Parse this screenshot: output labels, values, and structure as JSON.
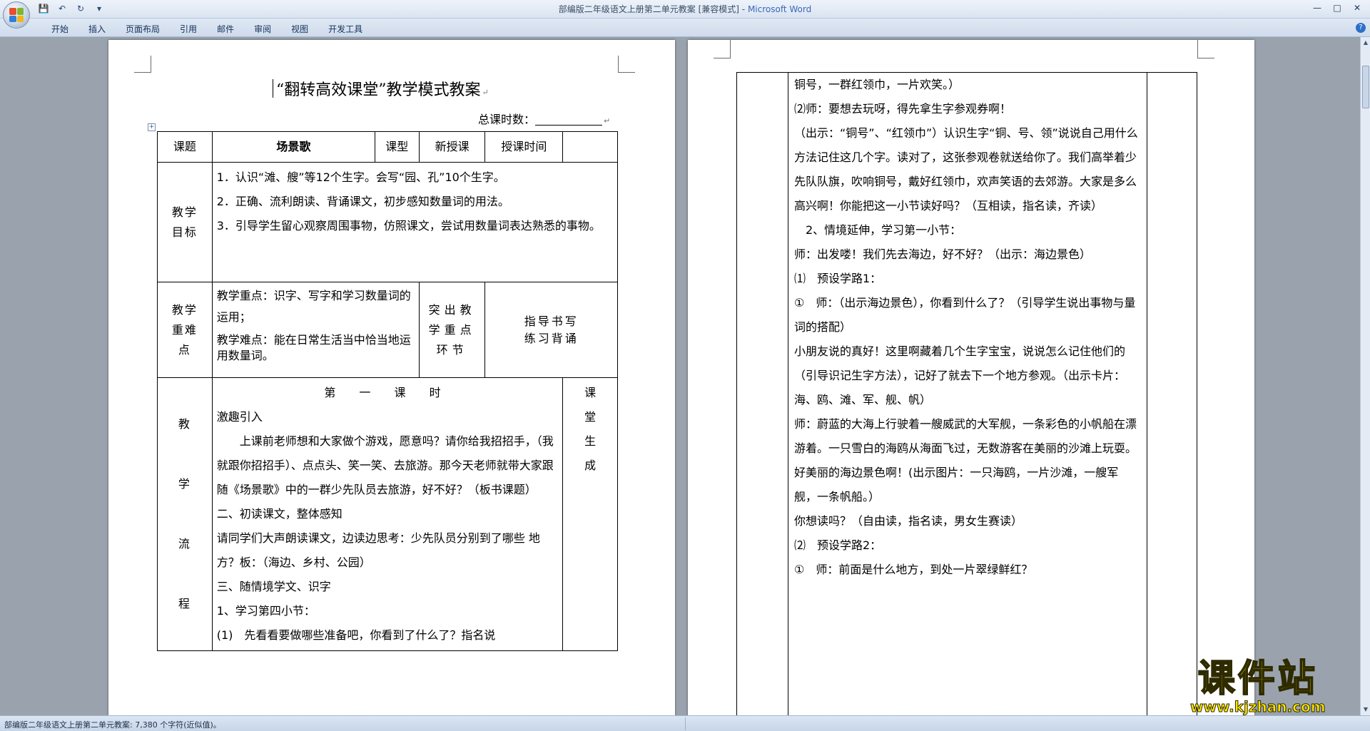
{
  "window": {
    "title": "部编版二年级语文上册第二单元教案 [兼容模式]",
    "app_name": "Microsoft Word"
  },
  "ribbon": {
    "tabs": [
      "开始",
      "插入",
      "页面布局",
      "引用",
      "邮件",
      "审阅",
      "视图",
      "开发工具"
    ]
  },
  "doc": {
    "title": "“翻转高效课堂”教学模式教案",
    "total_hours_label": "总课时数：",
    "header_row": {
      "subject_label": "课题",
      "subject": "场景歌",
      "type_label": "课型",
      "type": "新授课",
      "time_label": "授课时间",
      "time_value": ""
    },
    "goals_label": "教学目标",
    "goals": [
      "1．认识“滩、艘”等12个生字。会写“园、孔”10个生字。",
      "2．正确、流利朗读、背诵课文，初步感知数量词的用法。",
      "3．引导学生留心观察周围事物，仿照课文，尝试用数量词表达熟悉的事物。"
    ],
    "difficulty_label": "教学重难点",
    "key_point": "教学重点：识字、写字和学习数量词的运用；",
    "difficult_point": "教学难点：能在日常生活当中恰当地运用数量词。",
    "highlight_label": "突出教学重点环节",
    "highlight_value": "指导书写\n练习背诵",
    "process_label": "教学流程",
    "period_title": "第 一 课 时",
    "generate_label": "课堂生成",
    "process": [
      "激趣引入",
      "上课前老师想和大家做个游戏，愿意吗？请你给我招招手，（我就跟你招招手）、点点头、笑一笑、去旅游。那今天老师就带大家跟随《场景歌》中的一群少先队员去旅游，好不好？（板书课题）",
      "二、初读课文，整体感知",
      "请同学们大声朗读课文，边读边思考：少先队员分别到了哪些 地方？板：（海边、乡村、公园）",
      "三、随情境学文、识字",
      "1、学习第四小节：",
      "(1)　先看看要做哪些准备吧，你看到了什么了？指名说"
    ]
  },
  "page2": {
    "paragraphs": [
      "铜号，一群红领巾，一片欢笑。）",
      "⑵师：要想去玩呀，得先拿生字参观券啊！",
      "（出示：“铜号”、“红领巾”）认识生字“铜、号、领”说说自己用什么方法记住这几个字。读对了，这张参观卷就送给你了。我们高举着少先队队旗，吹响铜号，戴好红领巾，欢声笑语的去郊游。大家是多么高兴啊！你能把这一小节读好吗？（互相读，指名读，齐读）",
      "　2、情境延伸，学习第一小节：",
      "师：出发喽！我们先去海边，好不好？（出示：海边景色）",
      "⑴　预设学路1：",
      "①　师：（出示海边景色），你看到什么了？（引导学生说出事物与量词的搭配）",
      "小朋友说的真好！这里啊藏着几个生字宝宝，说说怎么记住他们的（引导识记生字方法），记好了就去下一个地方参观。（出示卡片：海、鸥、滩、军、舰、帆）",
      "师：蔚蓝的大海上行驶着一艘威武的大军舰，一条彩色的小帆船在漂游着。一只雪白的海鸥从海面飞过，无数游客在美丽的沙滩上玩耍。好美丽的海边景色啊！(出示图片：一只海鸥，一片沙滩，一艘军舰，一条帆船。）",
      "你想读吗？（自由读，指名读，男女生赛读）",
      "⑵　预设学路2：",
      "①　师：前面是什么地方，到处一片翠绿鲜红？"
    ]
  },
  "statusbar": {
    "text": "部编版二年级语文上册第二单元教案: 7,380 个字符(近似值)。"
  },
  "watermark": {
    "main": "课件站",
    "sub": "www.kjzhan.com"
  },
  "icons": {
    "office": "office-button-icon",
    "save": "save-icon",
    "undo": "undo-icon",
    "redo": "redo-icon",
    "help": "help-icon"
  }
}
